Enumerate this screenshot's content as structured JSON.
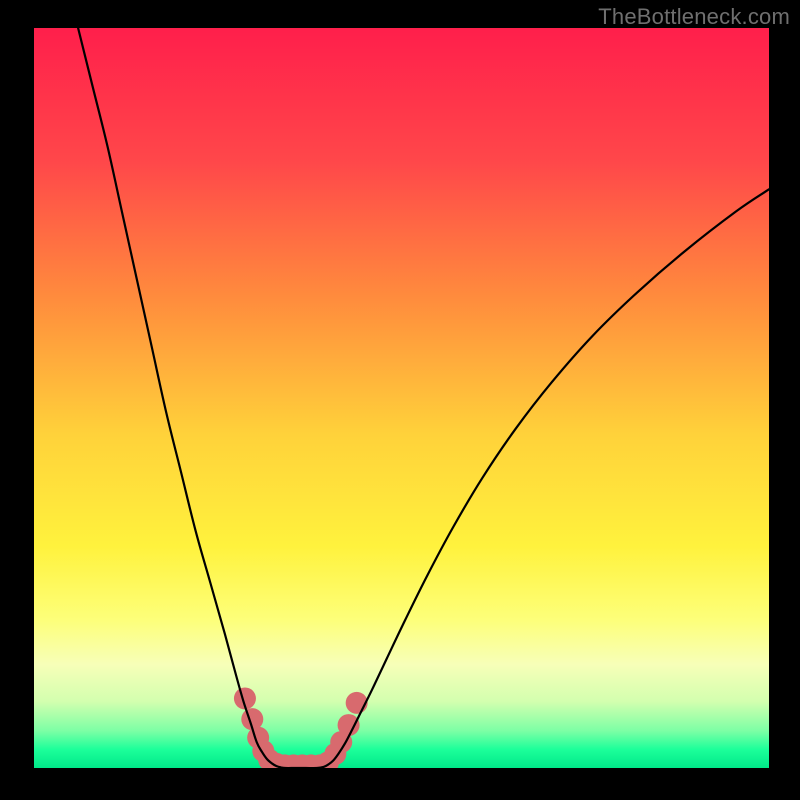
{
  "watermark": "TheBottleneck.com",
  "chart_data": {
    "type": "line",
    "title": "",
    "xlabel": "",
    "ylabel": "",
    "xlim": [
      0,
      100
    ],
    "ylim": [
      0,
      100
    ],
    "gradient_stops": [
      {
        "offset": 0.0,
        "color": "#ff1f4b"
      },
      {
        "offset": 0.18,
        "color": "#ff474a"
      },
      {
        "offset": 0.36,
        "color": "#ff8a3d"
      },
      {
        "offset": 0.55,
        "color": "#ffd23a"
      },
      {
        "offset": 0.7,
        "color": "#fff23d"
      },
      {
        "offset": 0.8,
        "color": "#fdff7a"
      },
      {
        "offset": 0.86,
        "color": "#f7ffb8"
      },
      {
        "offset": 0.91,
        "color": "#d3ffaf"
      },
      {
        "offset": 0.95,
        "color": "#7cffa5"
      },
      {
        "offset": 0.975,
        "color": "#1cff9a"
      },
      {
        "offset": 1.0,
        "color": "#00e889"
      }
    ],
    "series": [
      {
        "name": "bottleneck-curve",
        "type": "line",
        "color": "#000000",
        "width": 2.2,
        "points": [
          {
            "x": 6.0,
            "y": 100.0
          },
          {
            "x": 8.0,
            "y": 92.0
          },
          {
            "x": 10.0,
            "y": 84.0
          },
          {
            "x": 12.0,
            "y": 75.0
          },
          {
            "x": 14.0,
            "y": 66.0
          },
          {
            "x": 16.0,
            "y": 57.0
          },
          {
            "x": 18.0,
            "y": 48.0
          },
          {
            "x": 20.0,
            "y": 40.0
          },
          {
            "x": 22.0,
            "y": 32.0
          },
          {
            "x": 24.0,
            "y": 25.0
          },
          {
            "x": 26.0,
            "y": 18.0
          },
          {
            "x": 27.5,
            "y": 12.5
          },
          {
            "x": 28.5,
            "y": 9.0
          },
          {
            "x": 29.5,
            "y": 6.0
          },
          {
            "x": 30.3,
            "y": 3.5
          },
          {
            "x": 31.0,
            "y": 2.2
          },
          {
            "x": 31.7,
            "y": 1.2
          },
          {
            "x": 32.4,
            "y": 0.6
          },
          {
            "x": 33.0,
            "y": 0.25
          },
          {
            "x": 33.6,
            "y": 0.08
          },
          {
            "x": 34.2,
            "y": 0.0
          },
          {
            "x": 35.5,
            "y": 0.0
          },
          {
            "x": 37.0,
            "y": 0.0
          },
          {
            "x": 38.5,
            "y": 0.0
          },
          {
            "x": 39.4,
            "y": 0.15
          },
          {
            "x": 40.0,
            "y": 0.45
          },
          {
            "x": 40.7,
            "y": 1.0
          },
          {
            "x": 41.4,
            "y": 1.9
          },
          {
            "x": 42.3,
            "y": 3.3
          },
          {
            "x": 43.3,
            "y": 5.2
          },
          {
            "x": 44.5,
            "y": 7.6
          },
          {
            "x": 46.0,
            "y": 10.6
          },
          {
            "x": 48.0,
            "y": 14.8
          },
          {
            "x": 50.5,
            "y": 20.0
          },
          {
            "x": 53.5,
            "y": 26.0
          },
          {
            "x": 57.0,
            "y": 32.5
          },
          {
            "x": 61.0,
            "y": 39.2
          },
          {
            "x": 65.5,
            "y": 45.8
          },
          {
            "x": 70.5,
            "y": 52.2
          },
          {
            "x": 76.0,
            "y": 58.4
          },
          {
            "x": 82.0,
            "y": 64.2
          },
          {
            "x": 88.5,
            "y": 69.8
          },
          {
            "x": 95.5,
            "y": 75.2
          },
          {
            "x": 100.0,
            "y": 78.2
          }
        ]
      },
      {
        "name": "highlight-blobs",
        "type": "scatter",
        "color": "#d86a6e",
        "radius": 11,
        "points": [
          {
            "x": 28.7,
            "y": 9.4
          },
          {
            "x": 29.7,
            "y": 6.6
          },
          {
            "x": 30.5,
            "y": 4.1
          },
          {
            "x": 31.2,
            "y": 2.3
          },
          {
            "x": 32.0,
            "y": 1.1
          },
          {
            "x": 33.0,
            "y": 0.55
          },
          {
            "x": 34.1,
            "y": 0.35
          },
          {
            "x": 35.3,
            "y": 0.35
          },
          {
            "x": 36.5,
            "y": 0.35
          },
          {
            "x": 37.7,
            "y": 0.35
          },
          {
            "x": 38.9,
            "y": 0.35
          },
          {
            "x": 40.0,
            "y": 0.75
          },
          {
            "x": 41.0,
            "y": 1.9
          },
          {
            "x": 41.8,
            "y": 3.5
          },
          {
            "x": 42.8,
            "y": 5.8
          },
          {
            "x": 43.9,
            "y": 8.8
          }
        ]
      }
    ]
  }
}
